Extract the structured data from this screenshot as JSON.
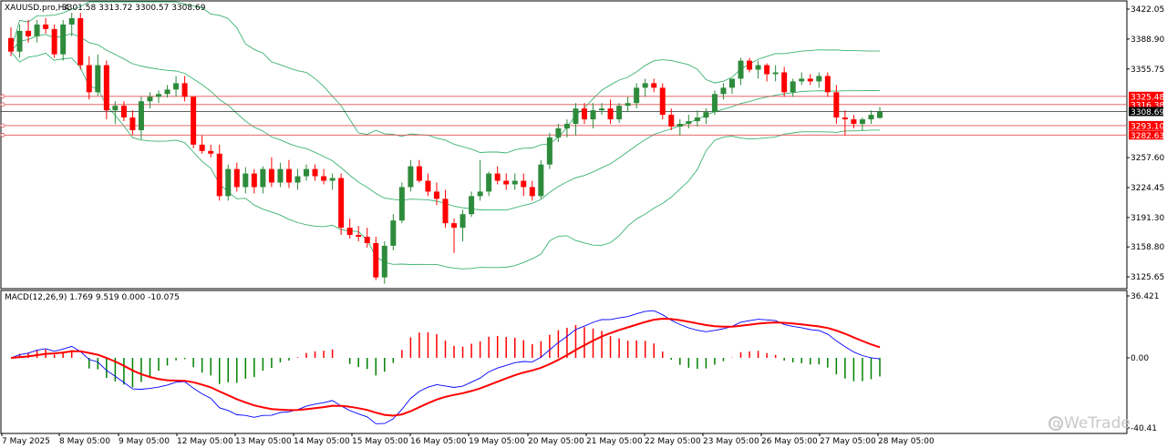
{
  "header": {
    "symbol_tf": "XAUUSD.pro,H4",
    "ohlc": "3301.58 3313.72 3300.57 3308.69"
  },
  "macd_header": "MACD(12,26,9) 1.769 9.519 0.000 -10.075",
  "watermark": "@WeTrade",
  "current_price_label": "3308.69",
  "colors": {
    "bull": "#2e8b3c",
    "bear": "#ff0000",
    "bands": "#3cb371",
    "level_line": "#e05050",
    "macd_main": "#0000ff",
    "macd_signal": "#ff0000",
    "hist_pos": "#ff0000",
    "hist_neg": "#008000",
    "label_bg": "#ff0000"
  },
  "levels": [
    "3325.48",
    "3316.38",
    "3293.10",
    "3282.63"
  ],
  "chart_data": [
    {
      "type": "candlestick",
      "title": "XAUUSD.pro,H4",
      "y_ticks": [
        "3422.05",
        "3388.90",
        "3355.75",
        "3325.48",
        "3316.38",
        "3308.69",
        "3293.10",
        "3282.63",
        "3257.60",
        "3224.45",
        "3191.30",
        "3158.80",
        "3125.65"
      ],
      "ylim": [
        3110,
        3430
      ],
      "x_ticks": [
        "7 May 2025",
        "8 May 05:00",
        "9 May 05:00",
        "12 May 05:00",
        "13 May 05:00",
        "14 May 05:00",
        "15 May 05:00",
        "16 May 05:00",
        "19 May 05:00",
        "20 May 05:00",
        "21 May 05:00",
        "22 May 05:00",
        "23 May 05:00",
        "26 May 05:00",
        "27 May 05:00",
        "28 May 05:00"
      ],
      "ohlc": [
        [
          3390,
          3402,
          3370,
          3375
        ],
        [
          3375,
          3405,
          3368,
          3398
        ],
        [
          3398,
          3410,
          3385,
          3392
        ],
        [
          3392,
          3410,
          3385,
          3405
        ],
        [
          3405,
          3412,
          3395,
          3400
        ],
        [
          3400,
          3405,
          3368,
          3372
        ],
        [
          3372,
          3410,
          3365,
          3405
        ],
        [
          3405,
          3418,
          3392,
          3412
        ],
        [
          3412,
          3418,
          3355,
          3360
        ],
        [
          3360,
          3370,
          3322,
          3330
        ],
        [
          3330,
          3372,
          3326,
          3360
        ],
        [
          3360,
          3365,
          3300,
          3310
        ],
        [
          3310,
          3320,
          3295,
          3315
        ],
        [
          3315,
          3320,
          3298,
          3302
        ],
        [
          3302,
          3310,
          3283,
          3288
        ],
        [
          3288,
          3325,
          3278,
          3320
        ],
        [
          3320,
          3330,
          3312,
          3325
        ],
        [
          3325,
          3332,
          3318,
          3328
        ],
        [
          3328,
          3338,
          3324,
          3333
        ],
        [
          3333,
          3348,
          3325,
          3340
        ],
        [
          3340,
          3348,
          3320,
          3325
        ],
        [
          3325,
          3300,
          3268,
          3272
        ],
        [
          3272,
          3282,
          3262,
          3265
        ],
        [
          3265,
          3272,
          3258,
          3262
        ],
        [
          3262,
          3272,
          3210,
          3215
        ],
        [
          3215,
          3250,
          3210,
          3245
        ],
        [
          3245,
          3252,
          3220,
          3225
        ],
        [
          3225,
          3247,
          3218,
          3240
        ],
        [
          3240,
          3245,
          3218,
          3225
        ],
        [
          3225,
          3248,
          3218,
          3245
        ],
        [
          3245,
          3258,
          3225,
          3230
        ],
        [
          3230,
          3252,
          3225,
          3245
        ],
        [
          3245,
          3255,
          3224,
          3230
        ],
        [
          3230,
          3245,
          3222,
          3237
        ],
        [
          3237,
          3250,
          3232,
          3245
        ],
        [
          3245,
          3250,
          3232,
          3237
        ],
        [
          3237,
          3245,
          3228,
          3232
        ],
        [
          3232,
          3240,
          3222,
          3235
        ],
        [
          3235,
          3240,
          3172,
          3180
        ],
        [
          3180,
          3190,
          3168,
          3172
        ],
        [
          3172,
          3182,
          3165,
          3170
        ],
        [
          3170,
          3180,
          3158,
          3163
        ],
        [
          3163,
          3170,
          3122,
          3125
        ],
        [
          3125,
          3165,
          3118,
          3160
        ],
        [
          3160,
          3195,
          3155,
          3188
        ],
        [
          3188,
          3230,
          3185,
          3225
        ],
        [
          3225,
          3255,
          3220,
          3248
        ],
        [
          3248,
          3255,
          3230,
          3232
        ],
        [
          3232,
          3240,
          3215,
          3220
        ],
        [
          3220,
          3230,
          3205,
          3212
        ],
        [
          3212,
          3222,
          3180,
          3185
        ],
        [
          3185,
          3190,
          3152,
          3180
        ],
        [
          3180,
          3200,
          3165,
          3195
        ],
        [
          3195,
          3220,
          3192,
          3215
        ],
        [
          3215,
          3255,
          3210,
          3220
        ],
        [
          3220,
          3242,
          3215,
          3240
        ],
        [
          3240,
          3248,
          3228,
          3232
        ],
        [
          3232,
          3240,
          3222,
          3228
        ],
        [
          3228,
          3240,
          3222,
          3232
        ],
        [
          3232,
          3240,
          3215,
          3225
        ],
        [
          3225,
          3232,
          3210,
          3215
        ],
        [
          3215,
          3255,
          3212,
          3250
        ],
        [
          3250,
          3285,
          3245,
          3280
        ],
        [
          3280,
          3295,
          3275,
          3290
        ],
        [
          3290,
          3300,
          3280,
          3295
        ],
        [
          3295,
          3318,
          3282,
          3312
        ],
        [
          3312,
          3318,
          3295,
          3300
        ],
        [
          3300,
          3318,
          3290,
          3310
        ],
        [
          3310,
          3318,
          3305,
          3312
        ],
        [
          3312,
          3322,
          3295,
          3300
        ],
        [
          3300,
          3318,
          3296,
          3315
        ],
        [
          3315,
          3325,
          3308,
          3318
        ],
        [
          3318,
          3340,
          3312,
          3335
        ],
        [
          3335,
          3345,
          3325,
          3340
        ],
        [
          3340,
          3345,
          3330,
          3335
        ],
        [
          3335,
          3340,
          3300,
          3305
        ],
        [
          3305,
          3312,
          3288,
          3292
        ],
        [
          3292,
          3300,
          3282,
          3295
        ],
        [
          3295,
          3305,
          3290,
          3298
        ],
        [
          3298,
          3310,
          3292,
          3302
        ],
        [
          3302,
          3312,
          3295,
          3308
        ],
        [
          3308,
          3332,
          3305,
          3328
        ],
        [
          3328,
          3340,
          3322,
          3335
        ],
        [
          3335,
          3345,
          3328,
          3345
        ],
        [
          3345,
          3368,
          3338,
          3365
        ],
        [
          3365,
          3368,
          3352,
          3355
        ],
        [
          3355,
          3365,
          3345,
          3360
        ],
        [
          3360,
          3362,
          3342,
          3350
        ],
        [
          3350,
          3360,
          3342,
          3352
        ],
        [
          3352,
          3358,
          3325,
          3330
        ],
        [
          3330,
          3345,
          3325,
          3342
        ],
        [
          3342,
          3352,
          3338,
          3345
        ],
        [
          3345,
          3350,
          3338,
          3342
        ],
        [
          3342,
          3352,
          3335,
          3348
        ],
        [
          3348,
          3352,
          3325,
          3330
        ],
        [
          3330,
          3338,
          3295,
          3302
        ],
        [
          3302,
          3310,
          3282,
          3300
        ],
        [
          3300,
          3305,
          3290,
          3295
        ],
        [
          3295,
          3302,
          3288,
          3300
        ],
        [
          3300,
          3310,
          3295,
          3305
        ],
        [
          3301.58,
          3313.72,
          3300.57,
          3308.69
        ]
      ]
    },
    {
      "type": "line",
      "title": "MACD(12,26,9)",
      "y_ticks": [
        "36.421",
        "0.00",
        "-40.41"
      ],
      "ylim": [
        -40.41,
        36.421
      ]
    }
  ]
}
